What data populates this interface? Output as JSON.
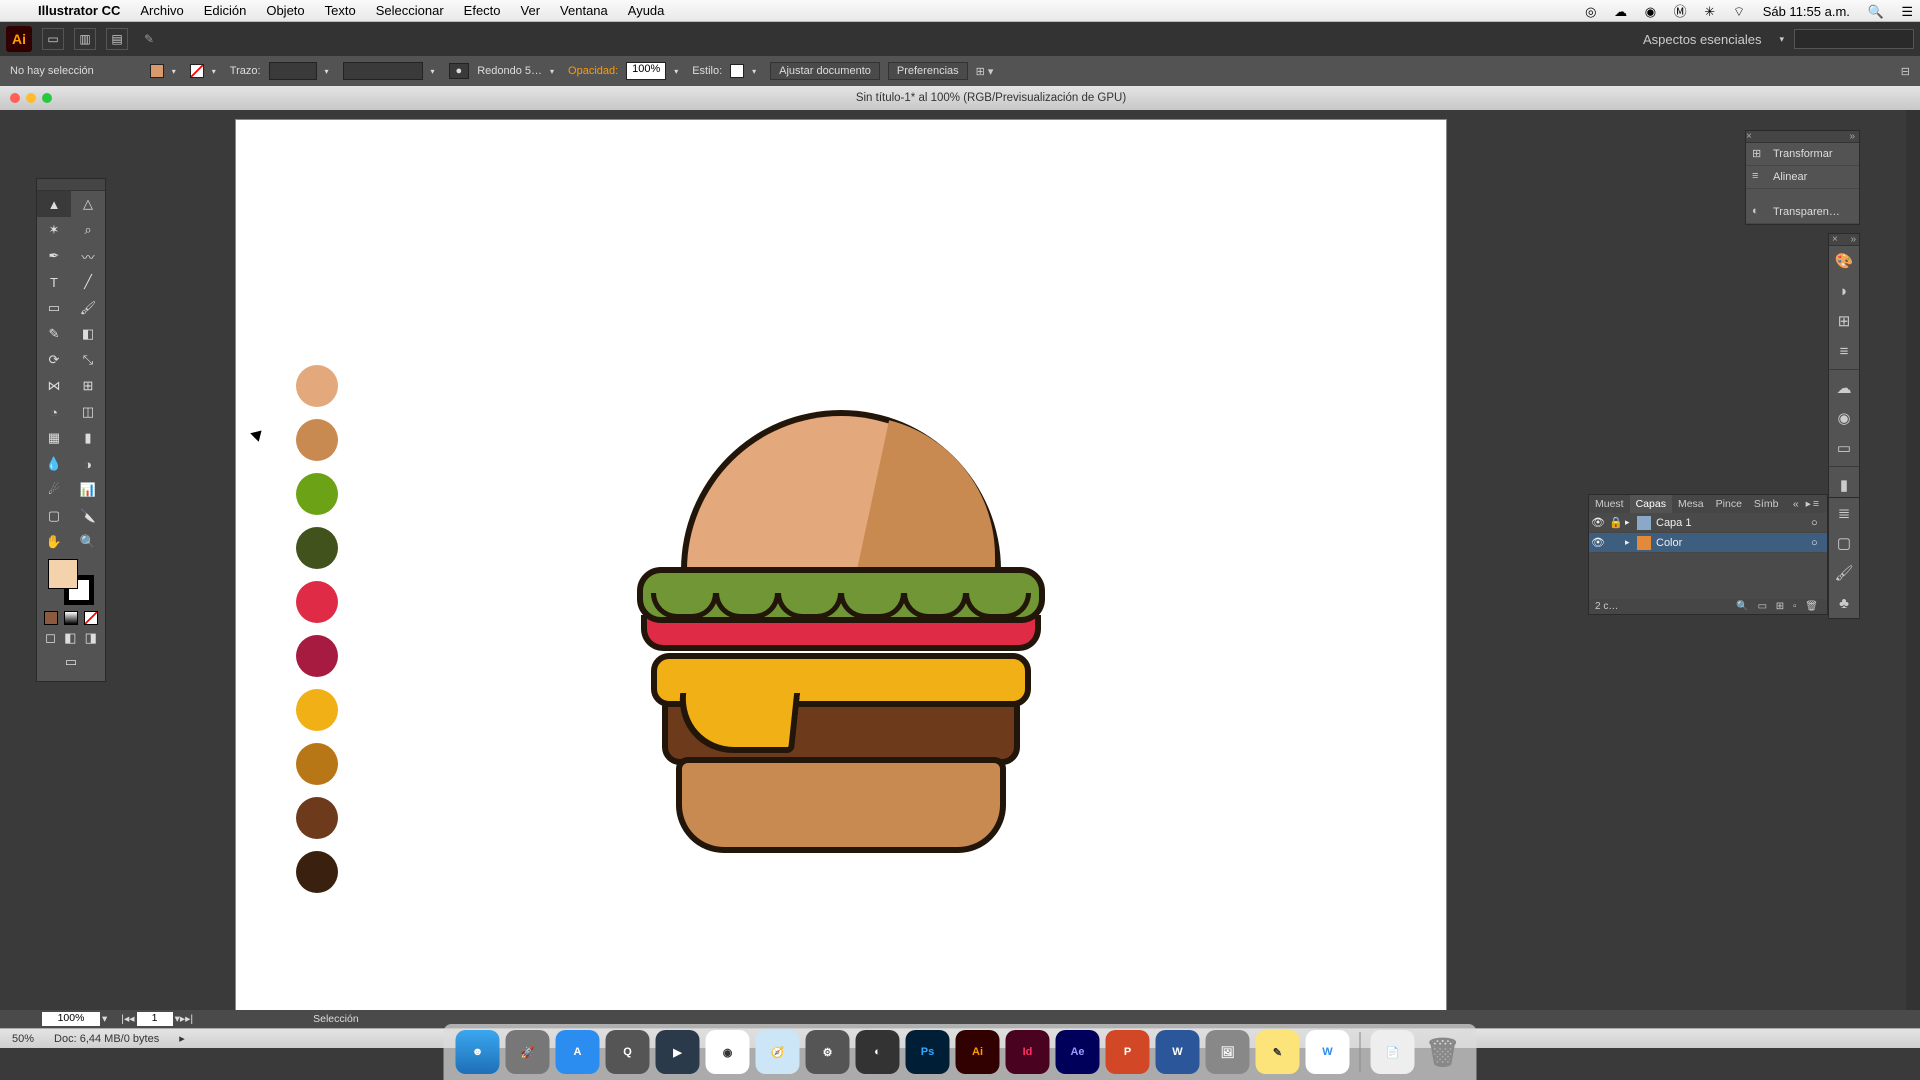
{
  "menubar": {
    "app": "Illustrator CC",
    "items": [
      "Archivo",
      "Edición",
      "Objeto",
      "Texto",
      "Seleccionar",
      "Efecto",
      "Ver",
      "Ventana",
      "Ayuda"
    ],
    "clock": "Sáb 11:55 a.m."
  },
  "workspace": {
    "label": "Aspectos esenciales"
  },
  "control_bar": {
    "selection": "No hay selección",
    "stroke_label": "Trazo:",
    "cap_label": "Redondo 5…",
    "opacity_label": "Opacidad:",
    "opacity_value": "100%",
    "style_label": "Estilo:",
    "fit_doc": "Ajustar documento",
    "prefs": "Preferencias"
  },
  "document": {
    "title": "Sin título-1* al 100% (RGB/Previsualización de GPU)"
  },
  "palette_colors": [
    "#e3a87b",
    "#c98a51",
    "#6ca316",
    "#41521c",
    "#e02b47",
    "#a81b41",
    "#f0b016",
    "#b87716",
    "#6d3b1c",
    "#3a200e"
  ],
  "panels": {
    "transform": "Transformar",
    "align": "Alinear",
    "transparency": "Transparen…"
  },
  "layers_panel": {
    "tabs": [
      "Muest",
      "Capas",
      "Mesa",
      "Pince",
      "Símb"
    ],
    "active_tab": "Capas",
    "rows": [
      {
        "name": "Capa 1",
        "color": "#8aa8c8",
        "selected": false
      },
      {
        "name": "Color",
        "color": "#e28a3a",
        "selected": true
      }
    ],
    "footer": "2 c…"
  },
  "zoom_bar": {
    "zoom": "100%",
    "page": "1",
    "mode": "Selección"
  },
  "status": {
    "zoom": "50%",
    "doc": "Doc: 6,44 MB/0 bytes"
  },
  "fill_color": "#f3d2ac"
}
